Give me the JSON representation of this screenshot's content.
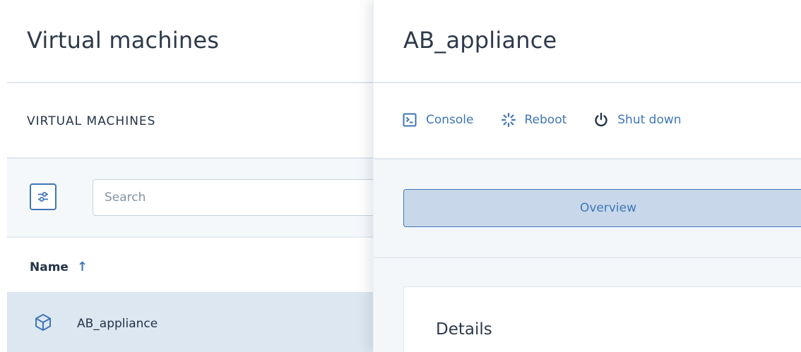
{
  "left_panel": {
    "title": "Virtual machines",
    "section_label": "VIRTUAL MACHINES",
    "search": {
      "placeholder": "Search",
      "value": ""
    },
    "table": {
      "column_header": "Name",
      "sort_direction": "ascending",
      "rows": [
        {
          "name": "AB_appliance",
          "icon": "vm-cube-icon",
          "selected": true
        }
      ]
    }
  },
  "right_panel": {
    "title": "AB_appliance",
    "actions": [
      {
        "label": "Console",
        "icon": "console-icon"
      },
      {
        "label": "Reboot",
        "icon": "reboot-icon"
      },
      {
        "label": "Shut down",
        "icon": "power-icon"
      }
    ],
    "tabs": [
      {
        "label": "Overview",
        "active": true
      }
    ],
    "details_card": {
      "title": "Details"
    }
  },
  "colors": {
    "accent": "#3f76b7",
    "text_primary": "#2e3a4a",
    "selected_row_bg": "#dde7f2",
    "active_tab_bg": "#c8d8ea",
    "panel_gray": "#f4f7fa"
  }
}
